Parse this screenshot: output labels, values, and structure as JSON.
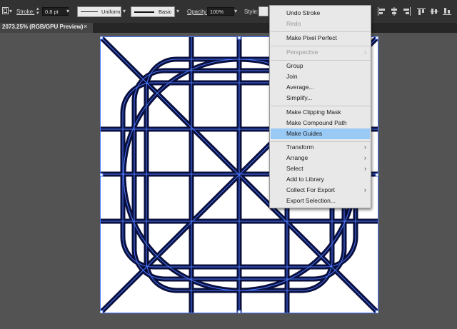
{
  "control_bar": {
    "stroke_label": "Stroke:",
    "stroke_weight": "0.8 pt",
    "profile_uniform": "Uniform",
    "brush_basic": "Basic",
    "opacity_label": "Opacity:",
    "opacity_value": "100%",
    "style_label": "Style:"
  },
  "document_tab": {
    "title": "2073.25% (RGB/GPU Preview)",
    "close": "×"
  },
  "context_menu": {
    "items": [
      {
        "label": "Undo Stroke",
        "enabled": true
      },
      {
        "label": "Redo",
        "enabled": false
      },
      {
        "label": "Make Pixel Perfect",
        "enabled": true
      },
      {
        "label": "Perspective",
        "enabled": false,
        "submenu": "›"
      },
      {
        "label": "Group",
        "enabled": true
      },
      {
        "label": "Join",
        "enabled": true
      },
      {
        "label": "Average...",
        "enabled": true
      },
      {
        "label": "Simplify...",
        "enabled": true
      },
      {
        "label": "Make Clipping Mask",
        "enabled": true
      },
      {
        "label": "Make Compound Path",
        "enabled": true
      },
      {
        "label": "Make Guides",
        "enabled": true,
        "highlighted": true
      },
      {
        "label": "Transform",
        "enabled": true,
        "submenu": "›"
      },
      {
        "label": "Arrange",
        "enabled": true,
        "submenu": "›"
      },
      {
        "label": "Select",
        "enabled": true,
        "submenu": "›"
      },
      {
        "label": "Add to Library",
        "enabled": true
      },
      {
        "label": "Collect For Export",
        "enabled": true,
        "submenu": "›"
      },
      {
        "label": "Export Selection...",
        "enabled": true
      }
    ]
  },
  "colors": {
    "app_background": "#535353",
    "control_bar": "#323232",
    "artboard": "#ffffff",
    "stroke": "#0a0f3c",
    "selection": "#4a78ff",
    "menu_highlight": "#99c9f5"
  },
  "icons": {
    "dropdown": "chevron-down-icon",
    "stepper": "stepper-icon",
    "submenu": "chevron-right-icon"
  }
}
